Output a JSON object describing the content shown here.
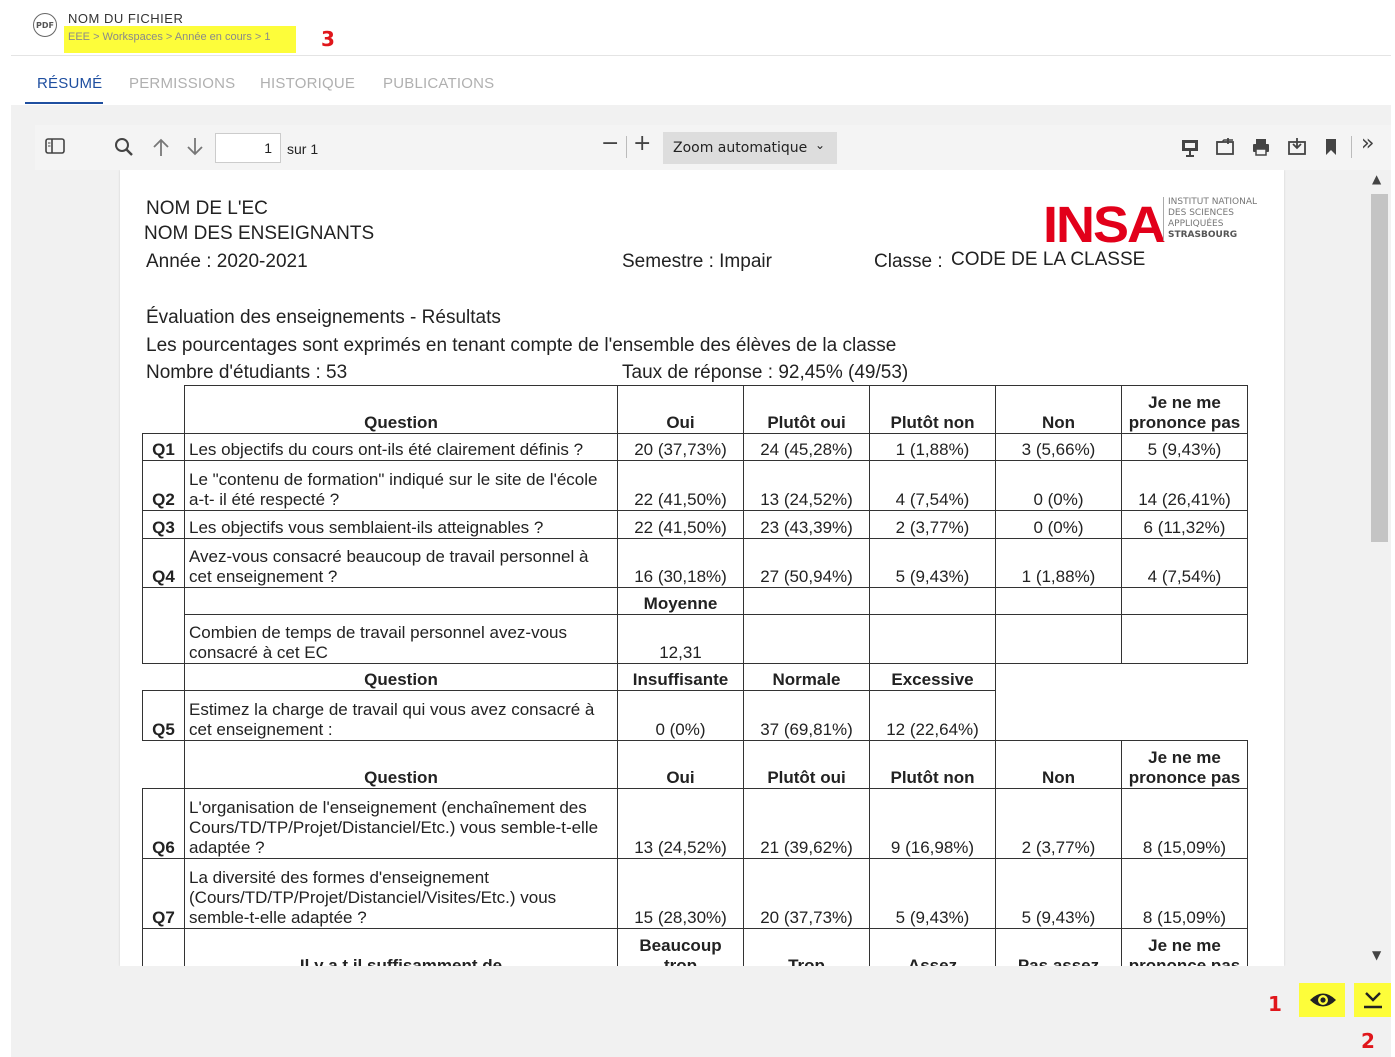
{
  "header": {
    "file_type_badge": "PDF",
    "file_name": "NOM DU FICHIER",
    "breadcrumb": "EEE > Workspaces > Année en cours > 1"
  },
  "annotations": {
    "a1": "1",
    "a2": "2",
    "a3": "3"
  },
  "tabs": [
    {
      "label": "RÉSUMÉ",
      "active": true
    },
    {
      "label": "PERMISSIONS",
      "active": false
    },
    {
      "label": "HISTORIQUE",
      "active": false
    },
    {
      "label": "PUBLICATIONS",
      "active": false
    }
  ],
  "toolbar": {
    "page_current": "1",
    "page_of": "sur 1",
    "zoom_value": "Zoom automatique",
    "icons": [
      "sidebar-toggle-icon",
      "search-icon",
      "arrow-up-icon",
      "arrow-down-icon",
      "minus-icon",
      "plus-icon",
      "presentation-icon",
      "open-file-icon",
      "print-icon",
      "download-icon",
      "bookmark-icon",
      "double-chevron-right-icon"
    ]
  },
  "document": {
    "ec_name": "NOM DE L'EC",
    "teachers": "NOM DES ENSEIGNANTS",
    "year": "Année : 2020-2021",
    "semester": "Semestre : Impair",
    "class_label": "Classe : ",
    "class_value": "CODE DE LA CLASSE",
    "logo": "INSA",
    "logo_sub": [
      "INSTITUT NATIONAL",
      "DES SCIENCES",
      "APPLIQUÉES",
      "STRASBOURG"
    ],
    "title": "Évaluation des enseignements - Résultats",
    "subtitle": "Les pourcentages sont exprimés en tenant compte de l'ensemble des élèves de la classe",
    "students": "Nombre d'étudiants : 53",
    "response_rate": "Taux de réponse : 92,45% (49/53)",
    "table": {
      "header1": [
        "Question",
        "Oui",
        "Plutôt oui",
        "Plutôt non",
        "Non",
        "Je ne me prononce pas"
      ],
      "rows1": [
        {
          "id": "Q1",
          "q": "Les objectifs du cours ont-ils été clairement définis ?",
          "v": [
            "20 (37,73%)",
            "24 (45,28%)",
            "1 (1,88%)",
            "3 (5,66%)",
            "5 (9,43%)"
          ]
        },
        {
          "id": "Q2",
          "q": "Le \"contenu de formation\" indiqué sur le site de l'école a-t- il été respecté ?",
          "v": [
            "22 (41,50%)",
            "13 (24,52%)",
            "4 (7,54%)",
            "0 (0%)",
            "14 (26,41%)"
          ]
        },
        {
          "id": "Q3",
          "q": "Les objectifs vous semblaient-ils atteignables ?",
          "v": [
            "22 (41,50%)",
            "23 (43,39%)",
            "2 (3,77%)",
            "0 (0%)",
            "6 (11,32%)"
          ]
        },
        {
          "id": "Q4",
          "q": "Avez-vous consacré beaucoup de travail personnel à cet enseignement ?",
          "v": [
            "16 (30,18%)",
            "27 (50,94%)",
            "5 (9,43%)",
            "1 (1,88%)",
            "4 (7,54%)"
          ]
        }
      ],
      "moyenne_label": "Moyenne",
      "moyenne_q": "Combien de temps de travail personnel avez-vous consacré à cet EC",
      "moyenne_value": "12,31",
      "header2": [
        "Question",
        "Insuffisante",
        "Normale",
        "Excessive"
      ],
      "q5": {
        "id": "Q5",
        "q": "Estimez la charge de travail qui vous avez consacré à cet enseignement :",
        "v": [
          "0 (0%)",
          "37 (69,81%)",
          "12 (22,64%)"
        ]
      },
      "header3": [
        "Question",
        "Oui",
        "Plutôt oui",
        "Plutôt non",
        "Non",
        "Je ne me prononce pas"
      ],
      "rows3": [
        {
          "id": "Q6",
          "q": "L'organisation de l'enseignement (enchaînement des Cours/TD/TP/Projet/Distanciel/Etc.) vous semble-t-elle adaptée ?",
          "v": [
            "13 (24,52%)",
            "21 (39,62%)",
            "9 (16,98%)",
            "2 (3,77%)",
            "8 (15,09%)"
          ]
        },
        {
          "id": "Q7",
          "q": "La diversité des formes d'enseignement (Cours/TD/TP/Projet/Distanciel/Visites/Etc.) vous semble-t-elle adaptée ?",
          "v": [
            "15 (28,30%)",
            "20 (37,73%)",
            "5 (9,43%)",
            "5 (9,43%)",
            "8 (15,09%)"
          ]
        }
      ],
      "header4": [
        "Il y a t il suffisamment de",
        "Beaucoup trop",
        "Trop",
        "Assez",
        "Pas assez",
        "Je ne me prononce pas"
      ]
    }
  },
  "actions": {
    "view_icon": "eye-icon",
    "download_icon": "download-icon"
  }
}
